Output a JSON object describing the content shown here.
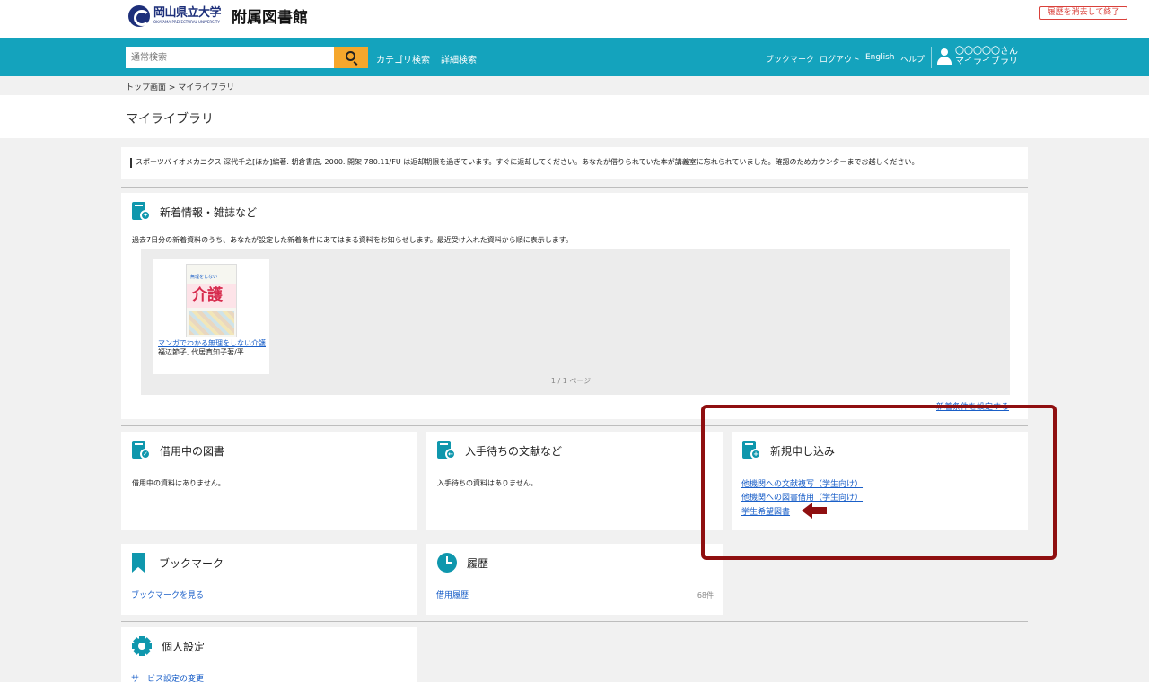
{
  "header": {
    "logo_university": "岡山県立大学",
    "logo_english": "OKAYAMA PREFECTURAL UNIVERSITY",
    "library_name": "附属図書館",
    "clear_history_label": "履歴を消去して終了"
  },
  "nav": {
    "search_placeholder": "通常検索",
    "category_search": "カテゴリ検索",
    "advanced_search": "詳細検索",
    "bookmark": "ブックマーク",
    "logout": "ログアウト",
    "english": "English",
    "help": "ヘルプ",
    "user_name": "〇〇〇〇〇さん",
    "my_library": "マイライブラリ"
  },
  "breadcrumb": "トップ画面 > マイライブラリ",
  "page_title": "マイライブラリ",
  "notice": "スポーツバイオメカニクス 深代千之[ほか]編著. 朝倉書店, 2000. 開架 780.11/FU は返却期限を過ぎています。すぐに返却してください。あなたが借りられていた本が講義室に忘れられていました。確認のためカウンターまでお越しください。",
  "new_arrivals": {
    "title": "新着情報・雑誌など",
    "description": "過去7日分の新着資料のうち、あなたが設定した新着条件にあてはまる資料をお知らせします。最近受け入れた資料から順に表示します。",
    "book_title": "マンガでわかる無理をしない介護",
    "book_author": "福辺節子, 代居真知子著/平…",
    "cover_sub": "無理をしない",
    "cover_title": "介護",
    "pager": "1 / 1 ページ",
    "condition_link": "新着条件を設定する"
  },
  "loans": {
    "title": "借用中の図書",
    "empty": "借用中の資料はありません。"
  },
  "waiting": {
    "title": "入手待ちの文献など",
    "empty": "入手待ちの資料はありません。"
  },
  "new_request": {
    "title": "新規申し込み",
    "links": [
      "他機関への文献複写（学生向け）",
      "他機関への図書借用（学生向け）",
      "学生希望図書"
    ]
  },
  "bookmark_panel": {
    "title": "ブックマーク",
    "link": "ブックマークを見る"
  },
  "history": {
    "title": "履歴",
    "link": "借用履歴",
    "count": "68件"
  },
  "settings": {
    "title": "個人設定",
    "link": "サービス設定の変更"
  },
  "colors": {
    "nav_bg": "#14a3bd",
    "accent_icon": "#0f97ad",
    "search_button": "#f5a72c",
    "highlight": "#8f0f10",
    "link": "#1a5fc8"
  }
}
